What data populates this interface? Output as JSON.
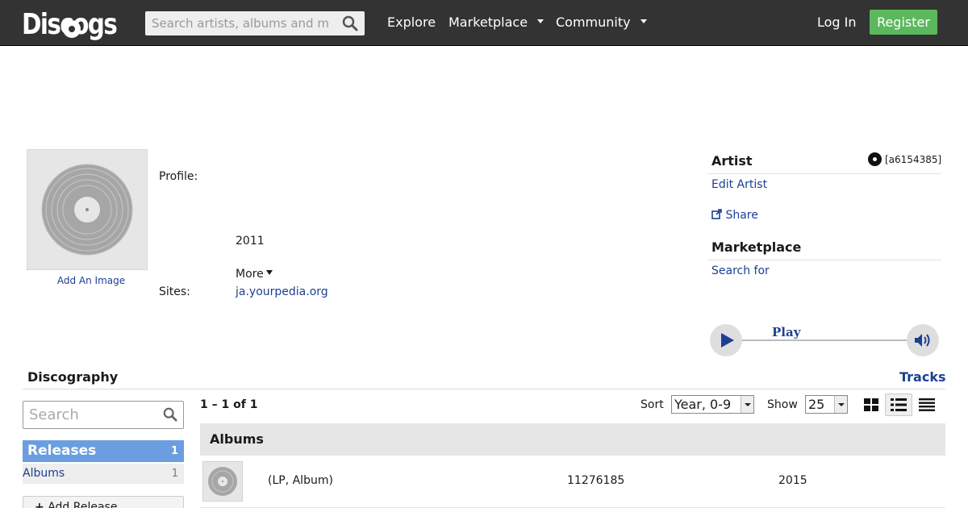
{
  "header": {
    "logo": "Discogs",
    "search_placeholder": "Search artists, albums and more...",
    "nav": [
      "Explore",
      "Marketplace",
      "Community"
    ],
    "login": "Log In",
    "register": "Register"
  },
  "artist": {
    "add_image": "Add An Image",
    "profile_label": "Profile:",
    "year": "2011",
    "more": "More",
    "sites_label": "Sites:",
    "site": "ja.yourpedia.org"
  },
  "sidebar": {
    "artist_heading": "Artist",
    "artist_id": "[a6154385]",
    "edit_artist": "Edit Artist",
    "share": "Share",
    "marketplace_heading": "Marketplace",
    "search_for": "Search for"
  },
  "player": {
    "play_label": "Play"
  },
  "discography": {
    "title": "Discography",
    "tracks": "Tracks",
    "search_placeholder": "Search",
    "releases_label": "Releases",
    "releases_count": "1",
    "albums_label": "Albums",
    "albums_count": "1",
    "add_release": "Add Release",
    "pager": "1 – 1 of 1",
    "sort_label": "Sort",
    "sort_value": "Year, 0-9",
    "show_label": "Show",
    "show_value": "25",
    "section_heading": "Albums",
    "rows": [
      {
        "format": "(LP, Album)",
        "catalog": "11276185",
        "year": "2015"
      }
    ]
  },
  "colors": {
    "header_bg": "#333333",
    "register_green": "#5cb85c",
    "link_blue": "#1c3f94",
    "releases_tab": "#6b9ee0"
  }
}
